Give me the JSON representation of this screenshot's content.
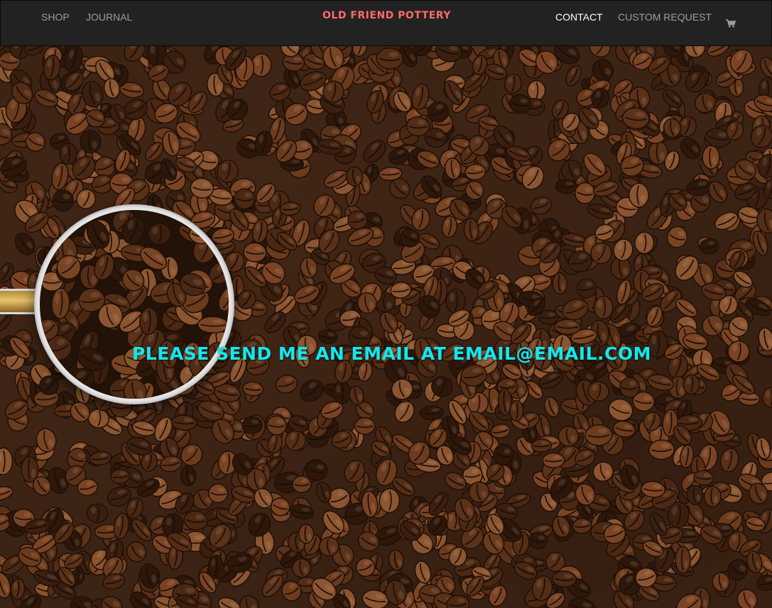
{
  "nav": {
    "left": [
      {
        "label": "SHOP"
      },
      {
        "label": "JOURNAL"
      }
    ],
    "brand": "OLD FRIEND POTTERY",
    "right": [
      {
        "label": "CONTACT",
        "active": true
      },
      {
        "label": "CUSTOM REQUEST"
      }
    ],
    "cart_icon": "shopping-cart-icon"
  },
  "hero": {
    "background": "coffee beans with metal scoop",
    "message": "PLEASE SEND ME AN EMAIL AT EMAIL@EMAIL.COM"
  },
  "colors": {
    "navbar_bg": "#222222",
    "nav_link": "#9d9d9d",
    "nav_active": "#ffffff",
    "brand": "#ff6a6a",
    "message": "#11e8f0"
  }
}
